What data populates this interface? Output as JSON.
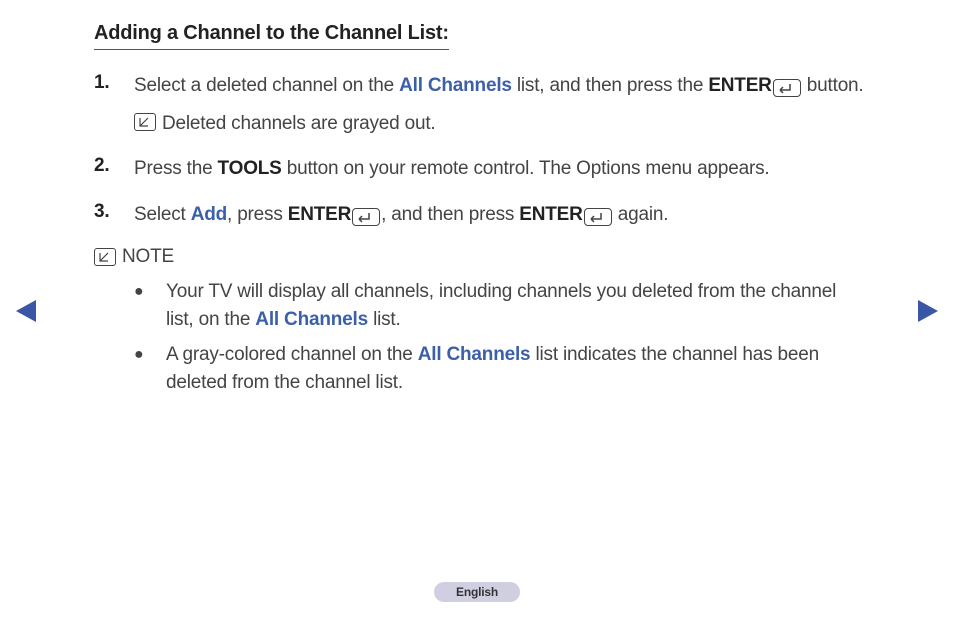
{
  "heading": "Adding a Channel to the Channel List:",
  "steps": [
    {
      "num": "1.",
      "parts": {
        "p1": "Select a deleted channel on the ",
        "blue1": "All Channels",
        "p2": " list, and then press the ",
        "bold1": "ENTER",
        "p3": " button."
      },
      "subnote": "Deleted channels are grayed out."
    },
    {
      "num": "2.",
      "parts": {
        "p1": "Press the ",
        "bold1": "TOOLS",
        "p2": " button on your remote control. The Options menu appears."
      }
    },
    {
      "num": "3.",
      "parts": {
        "p1": "Select ",
        "blue1": "Add",
        "p2": ", press ",
        "bold1": "ENTER",
        "p3": ", and then press ",
        "bold2": "ENTER",
        "p4": " again."
      }
    }
  ],
  "note_label": "NOTE",
  "bullets": [
    {
      "p1": "Your TV will display all channels, including channels you deleted from the channel list, on the ",
      "blue1": "All Channels",
      "p2": " list."
    },
    {
      "p1": "A gray-colored channel on the ",
      "blue1": "All Channels",
      "p2": " list indicates the channel has been deleted from the channel list."
    }
  ],
  "language": "English"
}
